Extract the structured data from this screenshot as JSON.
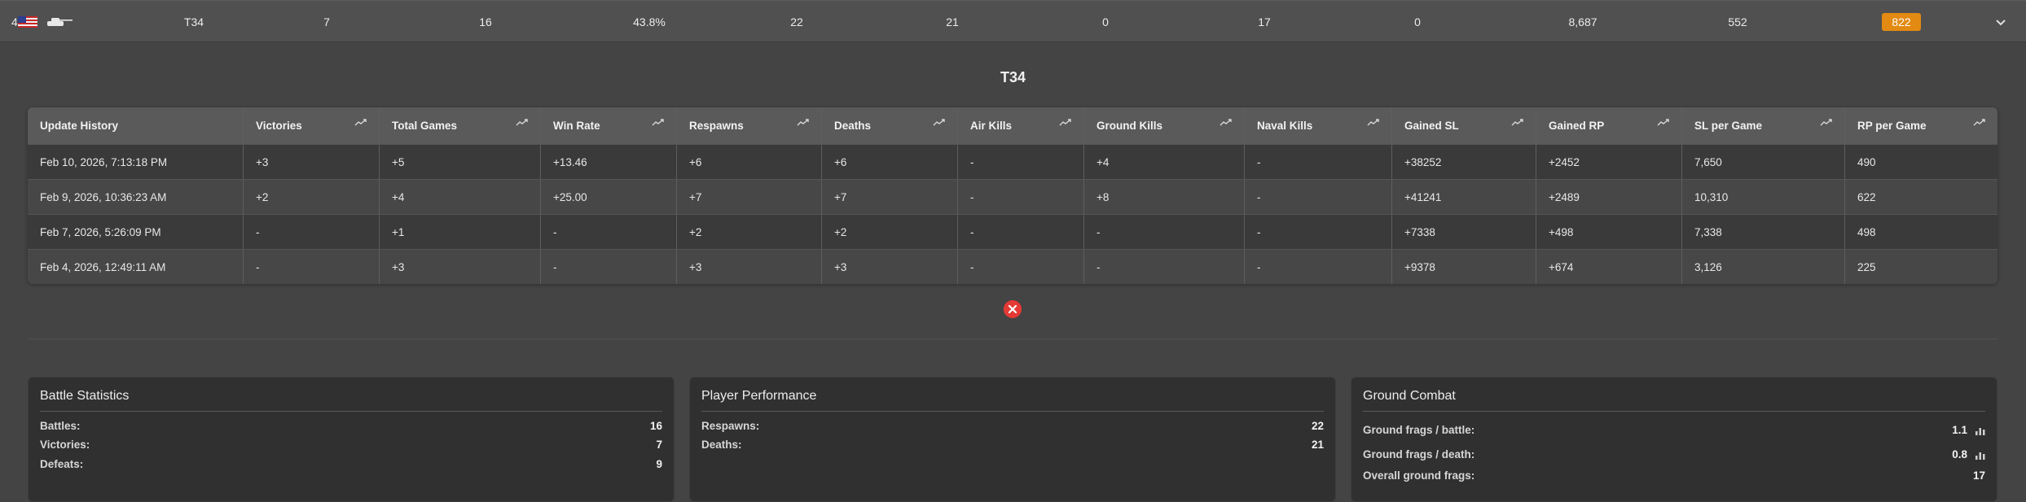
{
  "summary": {
    "rank": "4",
    "nation_icon": "us-flag-icon",
    "vehicle_type_icon": "tank-icon",
    "vehicle": "T34",
    "victories": "7",
    "total_games": "16",
    "win_rate": "43.8%",
    "respawns": "22",
    "deaths": "21",
    "air_kills": "0",
    "ground_kills": "17",
    "naval_kills": "0",
    "gained_sl": "8,687",
    "gained_rp": "552",
    "score_badge": "822",
    "badge_color": "#e38a12",
    "expand_icon": "chevron-down-icon"
  },
  "detail": {
    "title": "T34",
    "history": {
      "headers": [
        "Update History",
        "Victories",
        "Total Games",
        "Win Rate",
        "Respawns",
        "Deaths",
        "Air Kills",
        "Ground Kills",
        "Naval Kills",
        "Gained SL",
        "Gained RP",
        "SL per Game",
        "RP per Game"
      ],
      "trend_icon": "trend-chart-icon",
      "rows": [
        [
          "Feb 10, 2026, 7:13:18 PM",
          "+3",
          "+5",
          "+13.46",
          "+6",
          "+6",
          "-",
          "+4",
          "-",
          "+38252",
          "+2452",
          "7,650",
          "490"
        ],
        [
          "Feb 9, 2026, 10:36:23 AM",
          "+2",
          "+4",
          "+25.00",
          "+7",
          "+7",
          "-",
          "+8",
          "-",
          "+41241",
          "+2489",
          "10,310",
          "622"
        ],
        [
          "Feb 7, 2026, 5:26:09 PM",
          "-",
          "+1",
          "-",
          "+2",
          "+2",
          "-",
          "-",
          "-",
          "+7338",
          "+498",
          "7,338",
          "498"
        ],
        [
          "Feb 4, 2026, 12:49:11 AM",
          "-",
          "+3",
          "-",
          "+3",
          "+3",
          "-",
          "-",
          "-",
          "+9378",
          "+674",
          "3,126",
          "225"
        ]
      ]
    },
    "close_icon": "close-icon",
    "close_color": "#e53935"
  },
  "cards": {
    "battle": {
      "title": "Battle Statistics",
      "battles_label": "Battles:",
      "battles": "16",
      "victories_label": "Victories:",
      "victories": "7",
      "defeats_label": "Defeats:",
      "defeats": "9"
    },
    "performance": {
      "title": "Player Performance",
      "respawns_label": "Respawns:",
      "respawns": "22",
      "deaths_label": "Deaths:",
      "deaths": "21"
    },
    "ground": {
      "title": "Ground Combat",
      "frags_battle_label": "Ground frags / battle:",
      "frags_battle": "1.1",
      "frags_death_label": "Ground frags / death:",
      "frags_death": "0.8",
      "overall_label": "Overall ground frags:",
      "overall": "17",
      "bar_icon": "bar-chart-icon"
    }
  }
}
